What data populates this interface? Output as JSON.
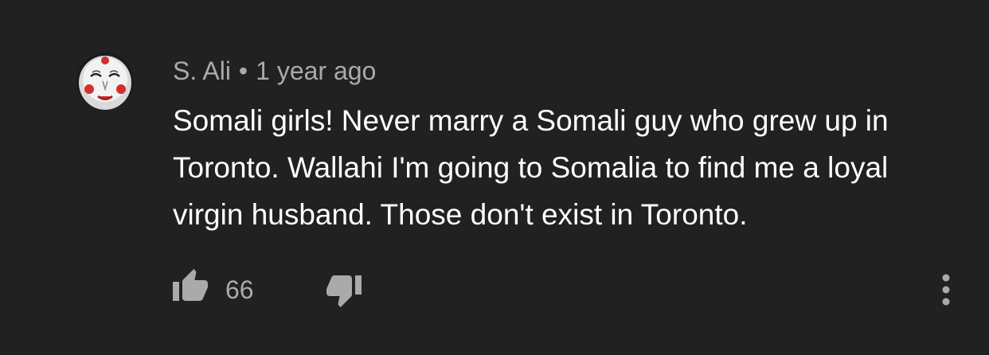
{
  "comment": {
    "author": "S. Ali",
    "separator": "•",
    "time": "1 year ago",
    "text": "Somali girls! Never marry a Somali guy who grew up in Toronto. Wallahi I'm going to Somalia to find me a loyal virgin husband. Those don't exist in Toronto.",
    "like_count": "66"
  },
  "icons": {
    "avatar": "mask-face-avatar",
    "like": "thumb-up-icon",
    "dislike": "thumb-down-icon",
    "more": "more-vertical-icon"
  },
  "colors": {
    "background": "#212121",
    "text": "#ffffff",
    "secondary_text": "#aaaaaa"
  }
}
